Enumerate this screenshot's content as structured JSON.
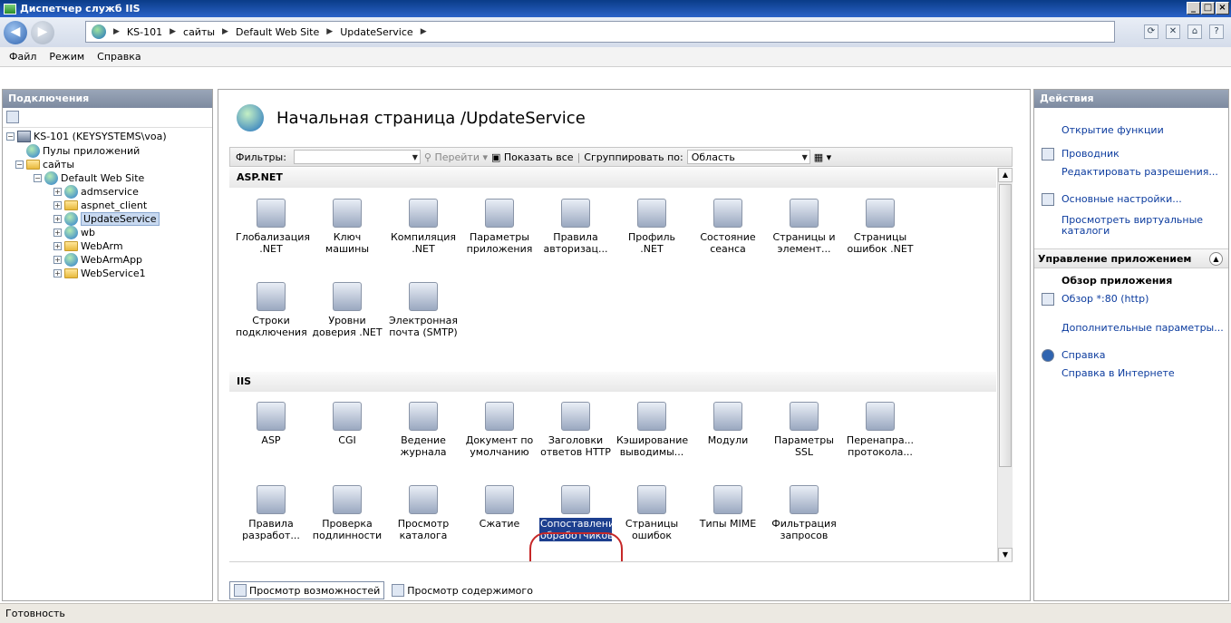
{
  "window": {
    "title": "Диспетчер служб IIS",
    "controls": [
      "_",
      "□",
      "×"
    ]
  },
  "address": {
    "crumbs": [
      "KS-101",
      "сайты",
      "Default Web Site",
      "UpdateService"
    ]
  },
  "menu": [
    "Файл",
    "Режим",
    "Справка"
  ],
  "connections": {
    "title": "Подключения",
    "tree": [
      {
        "label": "KS-101 (KEYSYSTEMS\\voa)",
        "icon": "server-icon"
      },
      {
        "label": "Пулы приложений",
        "icon": "app-pool-icon"
      },
      {
        "label": "сайты",
        "icon": "sites-folder-icon"
      },
      {
        "label": "Default Web Site",
        "icon": "site-globe-icon"
      },
      {
        "label": "admservice",
        "icon": "app-globe-icon"
      },
      {
        "label": "aspnet_client",
        "icon": "folder-icon"
      },
      {
        "label": "UpdateService",
        "icon": "app-globe-icon"
      },
      {
        "label": "wb",
        "icon": "app-globe-icon"
      },
      {
        "label": "WebArm",
        "icon": "folder-icon"
      },
      {
        "label": "WebArmApp",
        "icon": "app-globe-icon"
      },
      {
        "label": "WebService1",
        "icon": "folder-icon"
      }
    ]
  },
  "main": {
    "title": "Начальная страница /UpdateService",
    "filter_label": "Фильтры:",
    "go_label": "Перейти",
    "show_all_label": "Показать все",
    "group_by_label": "Сгруппировать по:",
    "group_by_value": "Область",
    "groups": [
      {
        "name": "ASP.NET"
      },
      {
        "name": "IIS"
      }
    ],
    "aspnet_features": [
      "Глобализация .NET",
      "Ключ машины",
      "Компиляция .NET",
      "Параметры приложения",
      "Правила авторизац...",
      "Профиль .NET",
      "Состояние сеанса",
      "Страницы и элемент...",
      "Страницы ошибок .NET",
      "Строки подключения",
      "Уровни доверия .NET",
      "Электронная почта (SMTP)"
    ],
    "iis_features": [
      "ASP",
      "CGI",
      "Ведение журнала",
      "Документ по умолчанию",
      "Заголовки ответов HTTP",
      "Кэширование выводимы...",
      "Модули",
      "Параметры SSL",
      "Перенапра... протокола...",
      "Правила разработ...",
      "Проверка подлинности",
      "Просмотр каталога",
      "Сжатие",
      "Сопоставления обработчиков",
      "Страницы ошибок",
      "Типы MIME",
      "Фильтрация запросов"
    ],
    "selected_feature": "Сопоставления обработчиков",
    "bottom_tabs": [
      "Просмотр возможностей",
      "Просмотр содержимого"
    ]
  },
  "actions": {
    "title": "Действия",
    "open_feature": "Открытие функции",
    "explore": "Проводник",
    "edit_permissions": "Редактировать разрешения...",
    "basic_settings": "Основные настройки...",
    "view_virtual_dirs": "Просмотреть виртуальные каталоги",
    "manage_app_title": "Управление приложением",
    "browse_app_title": "Обзор приложения",
    "browse_80": "Обзор *:80 (http)",
    "advanced_settings": "Дополнительные параметры...",
    "help": "Справка",
    "online_help": "Справка в Интернете"
  },
  "status": {
    "text": "Готовность"
  },
  "colors": {
    "selection": "#1d3f8f",
    "highlight_circle": "#c62828",
    "link": "#0b3b9e"
  }
}
